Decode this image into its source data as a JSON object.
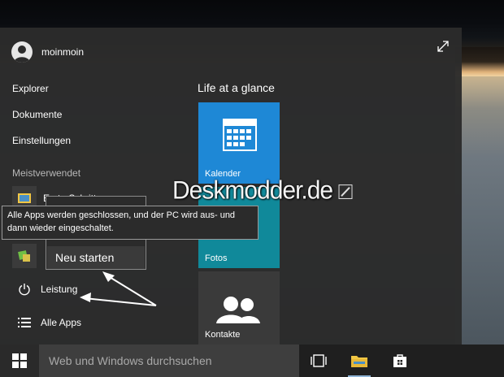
{
  "start_menu": {
    "user_name": "moinmoin",
    "nav": [
      "Explorer",
      "Dokumente",
      "Einstellungen"
    ],
    "most_used_label": "Meistverwendet",
    "most_used_apps": [
      {
        "label": "Erste Schritte",
        "icon": "get-started-icon"
      },
      {
        "label": "",
        "icon": "app-icon-green"
      }
    ],
    "power_label": "Leistung",
    "all_apps_label": "Alle Apps",
    "tile_group_title": "Life at a glance",
    "tiles": [
      {
        "label": "Kalender",
        "color": "#1e88d6",
        "icon": "calendar-icon"
      },
      {
        "label": "Fotos",
        "color": "#10899a",
        "icon": "photos-icon"
      },
      {
        "label": "Kontakte",
        "color": "#3a3a3a",
        "icon": "people-icon"
      }
    ]
  },
  "context_menu": {
    "restart_label": "Neu starten"
  },
  "tooltip": {
    "line1": "Alle Apps werden geschlossen, und der PC wird aus- und",
    "line2": "dann wieder eingeschaltet."
  },
  "watermark": "Deskmodder.de",
  "taskbar": {
    "search_placeholder": "Web und Windows durchsuchen",
    "icons": [
      "windows-logo-icon",
      "task-view-icon",
      "file-explorer-icon",
      "store-icon"
    ]
  },
  "colors": {
    "accent": "#1e88d6",
    "menu_background": "#2b2b2b",
    "taskbar": "#1f1f1f"
  }
}
